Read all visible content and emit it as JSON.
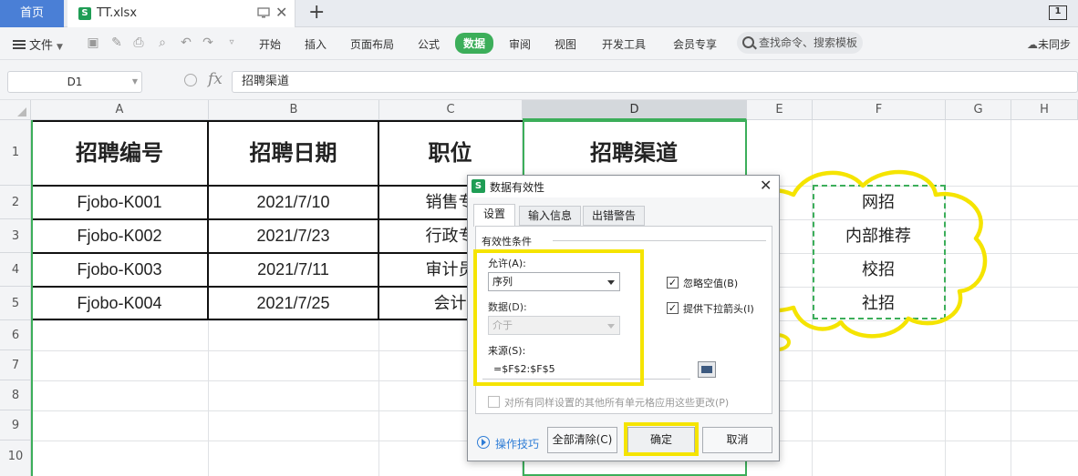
{
  "tabbar": {
    "home": "首页",
    "file_icon": "S",
    "file_name": "TT.xlsx",
    "window_badge": "1"
  },
  "ribbon": {
    "menu_label": "文件",
    "tabs": [
      "开始",
      "插入",
      "页面布局",
      "公式",
      "数据",
      "审阅",
      "视图",
      "开发工具",
      "会员专享"
    ],
    "active_tab": "数据",
    "search_placeholder": "查找命令、搜索模板",
    "sync_label": "未同步"
  },
  "formula_bar": {
    "cell_ref": "D1",
    "fx": "fx",
    "content": "招聘渠道"
  },
  "grid": {
    "columns": [
      "A",
      "B",
      "C",
      "D",
      "E",
      "F",
      "G",
      "H"
    ],
    "rows": [
      "1",
      "2",
      "3",
      "4",
      "5",
      "6",
      "7",
      "8",
      "9",
      "10"
    ],
    "headers": [
      "招聘编号",
      "招聘日期",
      "职位",
      "招聘渠道"
    ],
    "data": [
      [
        "Fjobo-K001",
        "2021/7/10",
        "销售专"
      ],
      [
        "Fjobo-K002",
        "2021/7/23",
        "行政专"
      ],
      [
        "Fjobo-K003",
        "2021/7/11",
        "审计员"
      ],
      [
        "Fjobo-K004",
        "2021/7/25",
        "会计"
      ]
    ],
    "source_list": [
      "网招",
      "内部推荐",
      "校招",
      "社招"
    ]
  },
  "dialog": {
    "icon": "S",
    "title": "数据有效性",
    "tabs": [
      "设置",
      "输入信息",
      "出错警告"
    ],
    "group_label": "有效性条件",
    "allow_label": "允许(A):",
    "allow_value": "序列",
    "data_label": "数据(D):",
    "data_value": "介于",
    "ignore_blank": "忽略空值(B)",
    "dropdown_arrow": "提供下拉箭头(I)",
    "source_label": "来源(S):",
    "source_value": "=$F$2:$F$5",
    "apply_all": "对所有同样设置的其他所有单元格应用这些更改(P)",
    "help": "操作技巧",
    "clear_all": "全部清除(C)",
    "ok": "确定",
    "cancel": "取消"
  },
  "colors": {
    "accent_green": "#3cae5a",
    "highlight_yellow": "#f5e400",
    "home_tab_blue": "#4a7fd6"
  }
}
